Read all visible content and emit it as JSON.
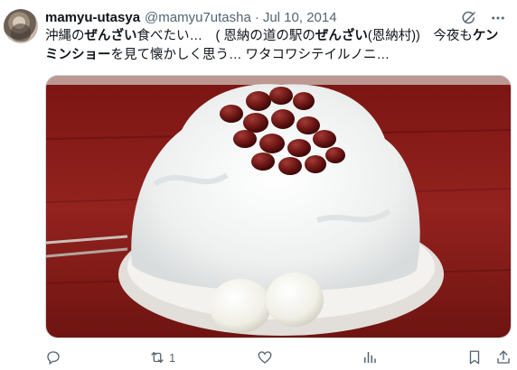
{
  "tweet": {
    "author_name": "mamyu-utasya",
    "author_handle": "@mamyu7utasha",
    "separator": "·",
    "date": "Jul 10, 2014",
    "text": {
      "p1": "沖縄の",
      "b1": "ぜんざい",
      "p2": "食べたい…　( 恩納の道の駅の",
      "b2": "ぜんざい",
      "p3": "(恩納村))　今夜も",
      "b3": "ケン",
      "b4": "ミンショー",
      "p4": "を見て懐かしく思う… ワタコワシテイルノニ…"
    },
    "media_icon": "shaved-ice-zenzai-photo",
    "actions": {
      "reply_icon": "reply-icon",
      "retweet_icon": "retweet-icon",
      "retweet_count": "1",
      "like_icon": "heart-icon",
      "views_icon": "views-icon",
      "bookmark_icon": "bookmark-icon",
      "share_icon": "share-icon"
    }
  },
  "colors": {
    "text_primary": "#0f1419",
    "text_secondary": "#536471",
    "border": "#cfd9de",
    "table_red": "#8e1d1a"
  }
}
